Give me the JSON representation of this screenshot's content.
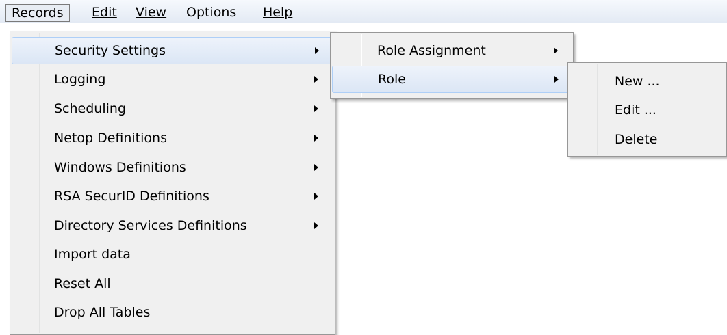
{
  "menubar": {
    "items": [
      {
        "label": "Records"
      },
      {
        "label": "Edit"
      },
      {
        "label": "View"
      },
      {
        "label": "Options"
      },
      {
        "label": "Help"
      }
    ]
  },
  "records_menu": {
    "items": [
      {
        "label": "Security Settings",
        "submenu": true,
        "highlighted": true
      },
      {
        "label": "Logging",
        "submenu": true
      },
      {
        "label": "Scheduling",
        "submenu": true
      },
      {
        "label": "Netop Definitions",
        "submenu": true
      },
      {
        "label": "Windows Definitions",
        "submenu": true
      },
      {
        "label": "RSA SecurID Definitions",
        "submenu": true
      },
      {
        "label": "Directory Services Definitions",
        "submenu": true
      },
      {
        "label": "Import data",
        "submenu": false
      },
      {
        "label": "Reset All",
        "submenu": false
      },
      {
        "label": "Drop All Tables",
        "submenu": false
      }
    ]
  },
  "security_submenu": {
    "items": [
      {
        "label": "Role Assignment",
        "submenu": true
      },
      {
        "label": "Role",
        "submenu": true,
        "highlighted": true
      }
    ]
  },
  "role_submenu": {
    "items": [
      {
        "label": "New ..."
      },
      {
        "label": "Edit ..."
      },
      {
        "label": "Delete"
      }
    ]
  },
  "colors": {
    "menu_background": "#f0f0f0",
    "highlight": "#dbe6f5",
    "highlight_border": "#aecff7"
  }
}
